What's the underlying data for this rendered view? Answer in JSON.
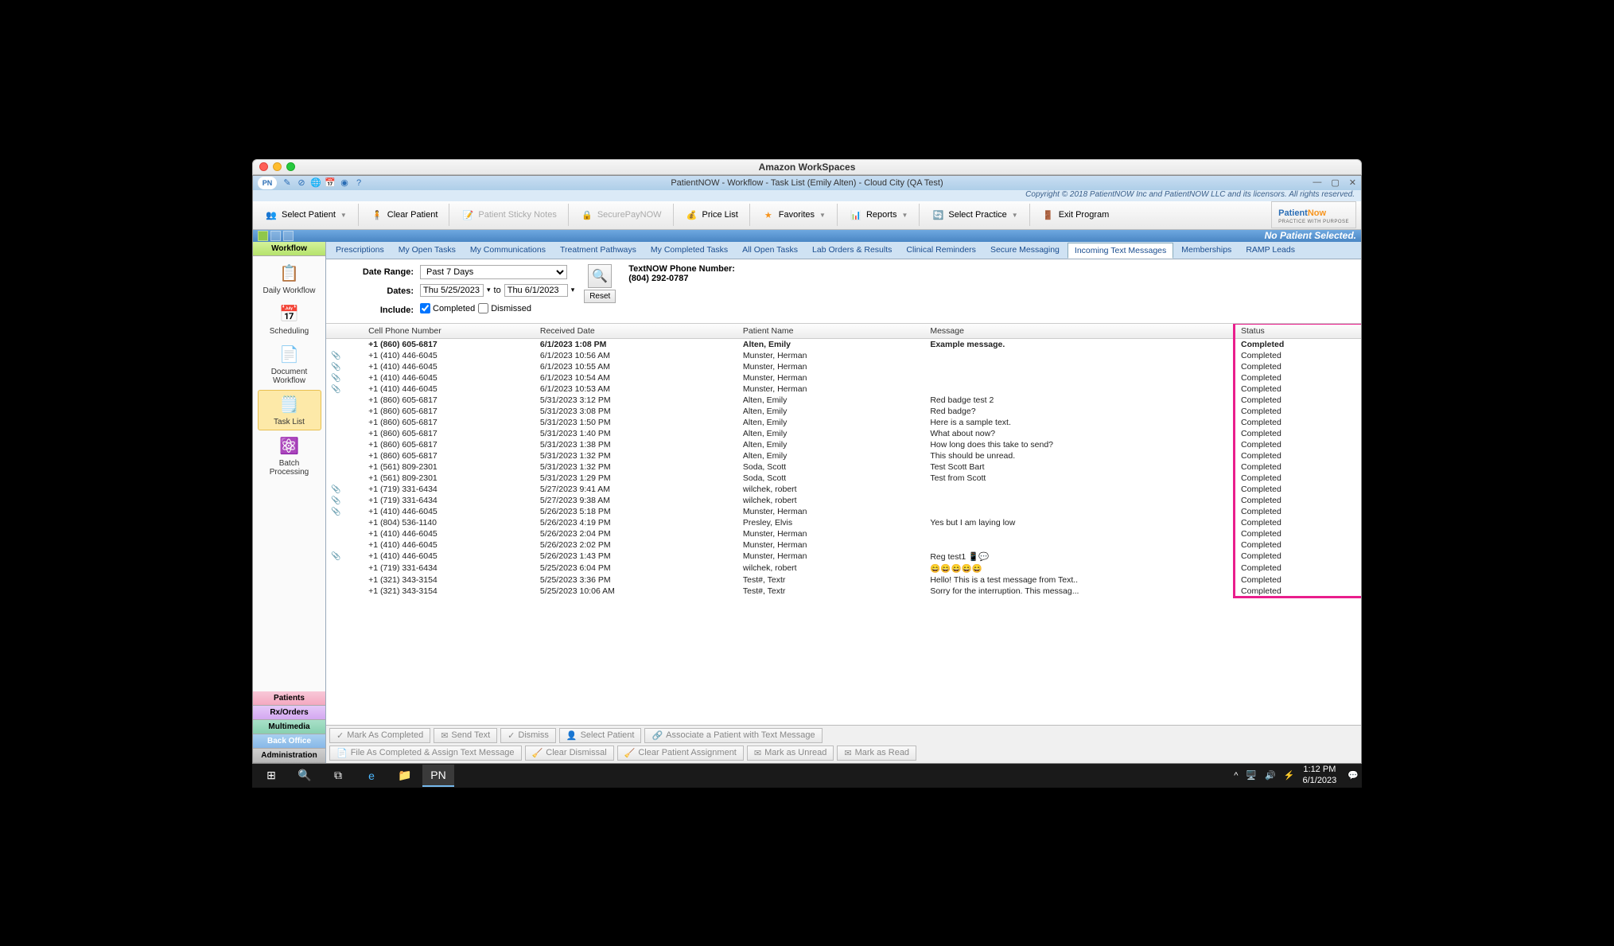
{
  "mac_title": "Amazon WorkSpaces",
  "app_title": "PatientNOW - Workflow - Task List (Emily Alten) - Cloud City (QA Test)",
  "copyright": "Copyright © 2018 PatientNOW Inc and PatientNOW LLC and its licensors. All rights reserved.",
  "toolbar": {
    "select_patient": "Select Patient",
    "clear_patient": "Clear Patient",
    "sticky_notes": "Patient Sticky Notes",
    "securepay": "SecurePayNOW",
    "price_list": "Price List",
    "favorites": "Favorites",
    "reports": "Reports",
    "select_practice": "Select Practice",
    "exit": "Exit Program"
  },
  "no_patient": "No Patient Selected.",
  "sidebar": {
    "headers": [
      "Workflow",
      "Patients",
      "Rx/Orders",
      "Multimedia",
      "Back Office",
      "Administration"
    ],
    "items": [
      {
        "label": "Daily Workflow",
        "icon": "📋"
      },
      {
        "label": "Scheduling",
        "icon": "📅"
      },
      {
        "label": "Document Workflow",
        "icon": "📄"
      },
      {
        "label": "Task List",
        "icon": "🗒️",
        "active": true
      },
      {
        "label": "Batch Processing",
        "icon": "⚛️"
      }
    ]
  },
  "tabs": [
    "Prescriptions",
    "My Open Tasks",
    "My Communications",
    "Treatment Pathways",
    "My Completed Tasks",
    "All Open Tasks",
    "Lab Orders & Results",
    "Clinical Reminders",
    "Secure Messaging",
    "Incoming Text Messages",
    "Memberships",
    "RAMP Leads"
  ],
  "active_tab": "Incoming Text Messages",
  "filters": {
    "date_range_label": "Date Range:",
    "date_range_value": "Past 7 Days",
    "dates_label": "Dates:",
    "date_from": "Thu 5/25/2023",
    "date_to": "Thu 6/1/2023",
    "to": "to",
    "include_label": "Include:",
    "completed": "Completed",
    "dismissed": "Dismissed",
    "reset": "Reset",
    "textnow_label": "TextNOW Phone Number:",
    "textnow_value": "(804) 292-0787"
  },
  "columns": [
    "Cell Phone Number",
    "Received Date",
    "Patient Name",
    "Message",
    "Status"
  ],
  "rows": [
    {
      "clip": false,
      "phone": "+1 (860) 605-6817",
      "date": "6/1/2023 1:08 PM",
      "name": "Alten, Emily",
      "msg": "Example message.",
      "status": "Completed",
      "sel": true
    },
    {
      "clip": true,
      "phone": "+1 (410) 446-6045",
      "date": "6/1/2023 10:56 AM",
      "name": "Munster, Herman",
      "msg": "",
      "status": "Completed"
    },
    {
      "clip": true,
      "phone": "+1 (410) 446-6045",
      "date": "6/1/2023 10:55 AM",
      "name": "Munster, Herman",
      "msg": "",
      "status": "Completed"
    },
    {
      "clip": true,
      "phone": "+1 (410) 446-6045",
      "date": "6/1/2023 10:54 AM",
      "name": "Munster, Herman",
      "msg": "",
      "status": "Completed"
    },
    {
      "clip": true,
      "phone": "+1 (410) 446-6045",
      "date": "6/1/2023 10:53 AM",
      "name": "Munster, Herman",
      "msg": "",
      "status": "Completed"
    },
    {
      "clip": false,
      "phone": "+1 (860) 605-6817",
      "date": "5/31/2023 3:12 PM",
      "name": "Alten, Emily",
      "msg": "Red badge test 2",
      "status": "Completed"
    },
    {
      "clip": false,
      "phone": "+1 (860) 605-6817",
      "date": "5/31/2023 3:08 PM",
      "name": "Alten, Emily",
      "msg": "Red badge?",
      "status": "Completed"
    },
    {
      "clip": false,
      "phone": "+1 (860) 605-6817",
      "date": "5/31/2023 1:50 PM",
      "name": "Alten, Emily",
      "msg": "Here is a sample text.",
      "status": "Completed"
    },
    {
      "clip": false,
      "phone": "+1 (860) 605-6817",
      "date": "5/31/2023 1:40 PM",
      "name": "Alten, Emily",
      "msg": "What about now?",
      "status": "Completed"
    },
    {
      "clip": false,
      "phone": "+1 (860) 605-6817",
      "date": "5/31/2023 1:38 PM",
      "name": "Alten, Emily",
      "msg": "How long does this take to send?",
      "status": "Completed"
    },
    {
      "clip": false,
      "phone": "+1 (860) 605-6817",
      "date": "5/31/2023 1:32 PM",
      "name": "Alten, Emily",
      "msg": "This should be unread.",
      "status": "Completed"
    },
    {
      "clip": false,
      "phone": "+1 (561) 809-2301",
      "date": "5/31/2023 1:32 PM",
      "name": "Soda, Scott",
      "msg": "Test Scott Bart",
      "status": "Completed"
    },
    {
      "clip": false,
      "phone": "+1 (561) 809-2301",
      "date": "5/31/2023 1:29 PM",
      "name": "Soda, Scott",
      "msg": "Test from Scott",
      "status": "Completed"
    },
    {
      "clip": true,
      "phone": "+1 (719) 331-6434",
      "date": "5/27/2023 9:41 AM",
      "name": "wilchek, robert",
      "msg": "",
      "status": "Completed"
    },
    {
      "clip": true,
      "phone": "+1 (719) 331-6434",
      "date": "5/27/2023 9:38 AM",
      "name": "wilchek, robert",
      "msg": "",
      "status": "Completed"
    },
    {
      "clip": true,
      "phone": "+1 (410) 446-6045",
      "date": "5/26/2023 5:18 PM",
      "name": "Munster, Herman",
      "msg": "",
      "status": "Completed"
    },
    {
      "clip": false,
      "phone": "+1 (804) 536-1140",
      "date": "5/26/2023 4:19 PM",
      "name": "Presley, Elvis",
      "msg": "Yes but I am laying low",
      "status": "Completed"
    },
    {
      "clip": false,
      "phone": "+1 (410) 446-6045",
      "date": "5/26/2023 2:04 PM",
      "name": "Munster, Herman",
      "msg": "",
      "status": "Completed"
    },
    {
      "clip": false,
      "phone": "+1 (410) 446-6045",
      "date": "5/26/2023 2:02 PM",
      "name": "Munster, Herman",
      "msg": "",
      "status": "Completed"
    },
    {
      "clip": true,
      "phone": "+1 (410) 446-6045",
      "date": "5/26/2023 1:43 PM",
      "name": "Munster, Herman",
      "msg": "Reg test1 📱💬",
      "status": "Completed"
    },
    {
      "clip": false,
      "phone": "+1 (719) 331-6434",
      "date": "5/25/2023 6:04 PM",
      "name": "wilchek, robert",
      "msg": "😄😄😄😄😄",
      "status": "Completed"
    },
    {
      "clip": false,
      "phone": "+1 (321) 343-3154",
      "date": "5/25/2023 3:36 PM",
      "name": "Test#, Textr",
      "msg": "Hello! This is a test message from Text..",
      "status": "Completed"
    },
    {
      "clip": false,
      "phone": "+1 (321) 343-3154",
      "date": "5/25/2023 10:06 AM",
      "name": "Test#, Textr",
      "msg": "Sorry for the interruption. This messag...",
      "status": "Completed"
    }
  ],
  "actions": {
    "row1": [
      "Mark As Completed",
      "Send Text",
      "Dismiss",
      "Select Patient",
      "Associate a Patient with Text Message"
    ],
    "row2": [
      "File As Completed & Assign Text Message",
      "Clear Dismissal",
      "Clear Patient Assignment",
      "Mark as Unread",
      "Mark as Read"
    ]
  },
  "taskbar": {
    "time": "1:12 PM",
    "date": "6/1/2023"
  }
}
